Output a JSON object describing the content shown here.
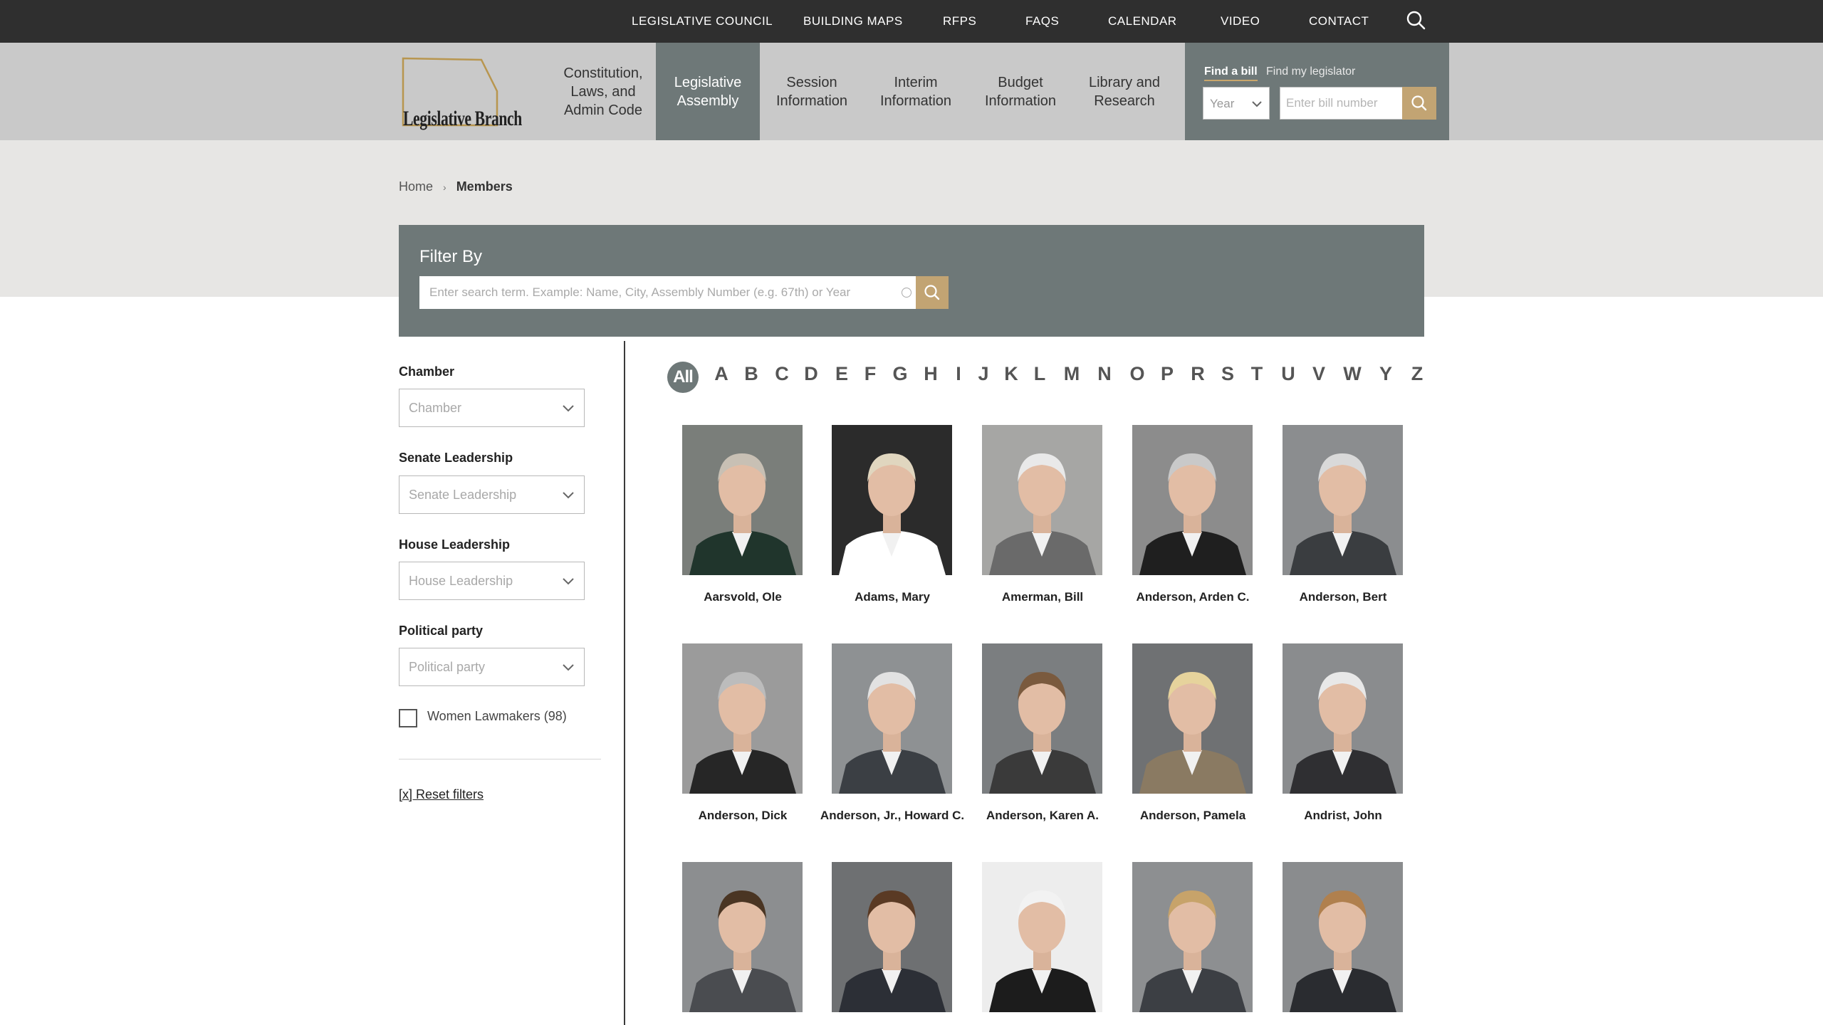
{
  "topbar": {
    "links": [
      "LEGISLATIVE COUNCIL",
      "BUILDING MAPS",
      "RFPS",
      "FAQS",
      "CALENDAR",
      "VIDEO",
      "CONTACT"
    ]
  },
  "logo": {
    "text": "Legislative Branch"
  },
  "nav": {
    "items": [
      "Constitution, Laws, and Admin Code",
      "Legislative Assembly",
      "Session Information",
      "Interim Information",
      "Budget Information",
      "Library and Research"
    ],
    "active": "Legislative Assembly"
  },
  "find": {
    "tabs": [
      "Find a bill",
      "Find my legislator"
    ],
    "active_tab": "Find a bill",
    "year_label": "Year",
    "bill_placeholder": "Enter bill number"
  },
  "breadcrumb": {
    "home": "Home",
    "sep": "›",
    "current": "Members"
  },
  "filter": {
    "title": "Filter By",
    "placeholder": "Enter search term. Example: Name, City, Assembly Number (e.g. 67th) or Year"
  },
  "sidebar": {
    "groups": [
      {
        "label": "Chamber",
        "placeholder": "Chamber"
      },
      {
        "label": "Senate Leadership",
        "placeholder": "Senate Leadership"
      },
      {
        "label": "House Leadership",
        "placeholder": "House Leadership"
      },
      {
        "label": "Political party",
        "placeholder": "Political party"
      }
    ],
    "checkbox_label": "Women Lawmakers (98)",
    "reset": "[x] Reset filters"
  },
  "alphabet": {
    "all": "All",
    "letters": [
      "A",
      "B",
      "C",
      "D",
      "E",
      "F",
      "G",
      "H",
      "I",
      "J",
      "K",
      "L",
      "M",
      "N",
      "O",
      "P",
      "R",
      "S",
      "T",
      "U",
      "V",
      "W",
      "Y",
      "Z"
    ]
  },
  "members": [
    "Aarsvold, Ole",
    "Adams, Mary",
    "Amerman, Bill",
    "Anderson, Arden C.",
    "Anderson, Bert",
    "Anderson, Dick",
    "Anderson, Jr., Howard C.",
    "Anderson, Karen A.",
    "Anderson, Pamela",
    "Andrist, John",
    "",
    "",
    "",
    "",
    ""
  ],
  "colors": {
    "topbar": "#2f2f2f",
    "nav_bg": "#c9c9c9",
    "accent_slate": "#6e7878",
    "accent_gold": "#c2a473",
    "band": "#e7e6e4"
  }
}
